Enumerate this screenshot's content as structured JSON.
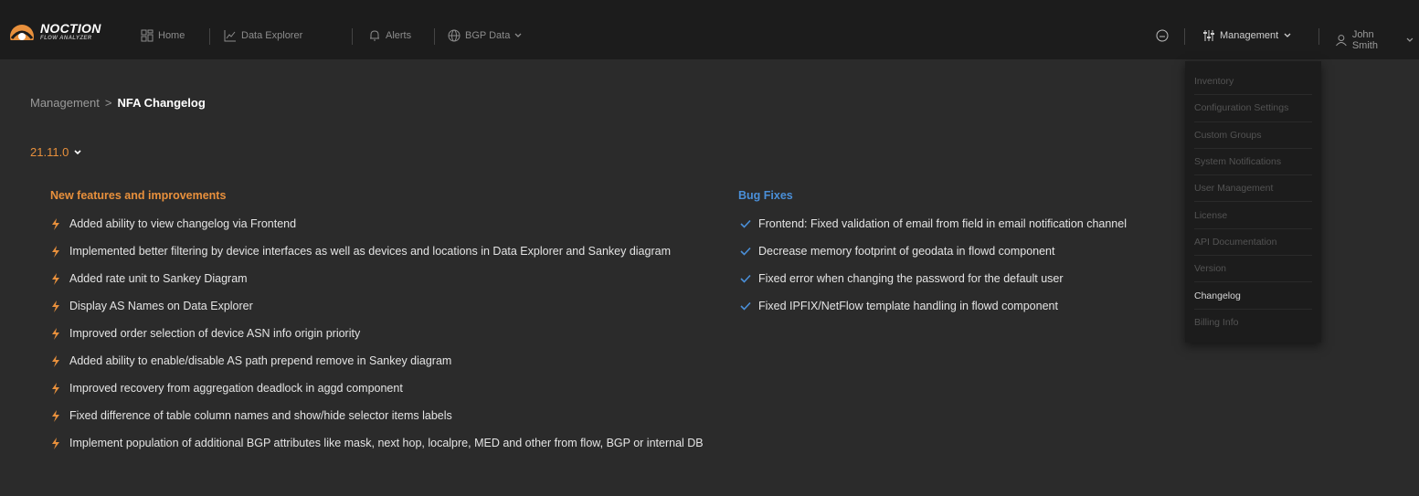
{
  "brand": {
    "name": "NOCTION",
    "subtitle": "FLOW ANALYZER"
  },
  "nav": {
    "home": "Home",
    "data_explorer": "Data Explorer",
    "alerts": "Alerts",
    "bgp_data": "BGP Data"
  },
  "header_right": {
    "management": "Management",
    "user": "John Smith"
  },
  "breadcrumb": {
    "parent": "Management",
    "separator": ">",
    "current": "NFA Changelog"
  },
  "version": "21.11.0",
  "features": {
    "title": "New features and improvements",
    "items": [
      "Added ability to view changelog via Frontend",
      "Implemented better filtering by device interfaces as well as devices and locations in Data Explorer and Sankey diagram",
      "Added rate unit to Sankey Diagram",
      "Display AS Names on Data Explorer",
      "Improved order selection of device ASN info origin priority",
      "Added ability to enable/disable AS path prepend remove in Sankey diagram",
      "Improved recovery from aggregation deadlock in aggd component",
      "Fixed difference of table column names and show/hide selector items labels",
      "Implement population of additional BGP attributes like mask, next hop, localpre, MED and other from flow, BGP or internal DB"
    ]
  },
  "bugs": {
    "title": "Bug Fixes",
    "items": [
      "Frontend: Fixed validation of email from field in email notification channel",
      "Decrease memory footprint of geodata in flowd component",
      "Fixed error when changing the password for the default user",
      "Fixed IPFIX/NetFlow template handling in flowd component"
    ]
  },
  "management_menu": {
    "items": [
      "Inventory",
      "Configuration Settings",
      "Custom Groups",
      "System Notifications",
      "User Management",
      "License",
      "API Documentation",
      "Version",
      "Changelog",
      "Billing Info"
    ],
    "active": "Changelog"
  },
  "colors": {
    "accent_orange": "#e8903c",
    "accent_blue": "#4a8fd8",
    "background": "#2b2b2b",
    "topbar": "#1c1c1c"
  },
  "icons": {
    "logo": "noction-logo-icon",
    "home": "dashboard-icon",
    "data_explorer": "chart-line-icon",
    "alerts": "bell-icon",
    "bgp_data": "globe-icon",
    "status": "smile-icon",
    "management": "sliders-icon",
    "user": "user-icon",
    "feature_bullet": "lightning-icon",
    "bug_bullet": "check-icon"
  }
}
